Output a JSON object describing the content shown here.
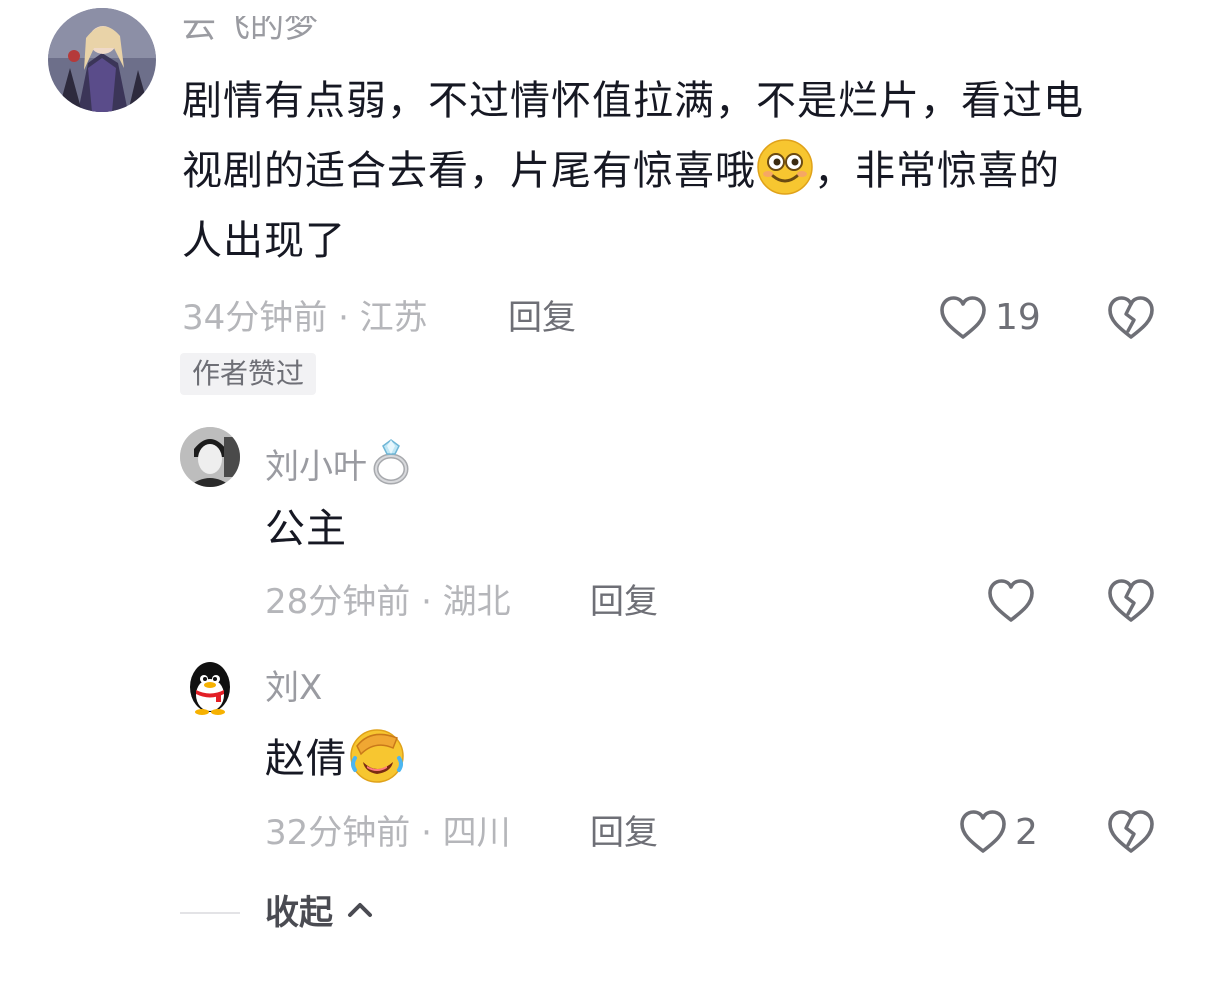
{
  "comment": {
    "username": "云飞的梦",
    "text_line1": "剧情有点弱，不过情怀值拉满，不是烂片，看过电",
    "text_line2a": "视剧的适合去看，片尾有惊喜哦",
    "text_line2b": "，非常惊喜的",
    "text_line3": "人出现了",
    "meta": "34分钟前 · 江苏",
    "reply_label": "回复",
    "likes": "19",
    "badge": "作者赞过",
    "emoji": "smile-emoji"
  },
  "replies": [
    {
      "username": "刘小叶",
      "username_icon": "ring-emoji",
      "text": "公主",
      "meta": "28分钟前 · 湖北",
      "reply_label": "回复",
      "likes": ""
    },
    {
      "username": "刘X",
      "text": "赵倩",
      "text_emoji": "facepalm-laugh-emoji",
      "meta": "32分钟前 · 四川",
      "reply_label": "回复",
      "likes": "2"
    }
  ],
  "footer": {
    "collapse_label": "收起",
    "collapse_icon": "chevron-up-icon"
  },
  "colors": {
    "text_primary": "#161823",
    "text_secondary": "#9a9ba1",
    "meta_text": "#b5b6ba",
    "icon_gray": "#6e6f76",
    "badge_bg": "#f2f2f4"
  }
}
